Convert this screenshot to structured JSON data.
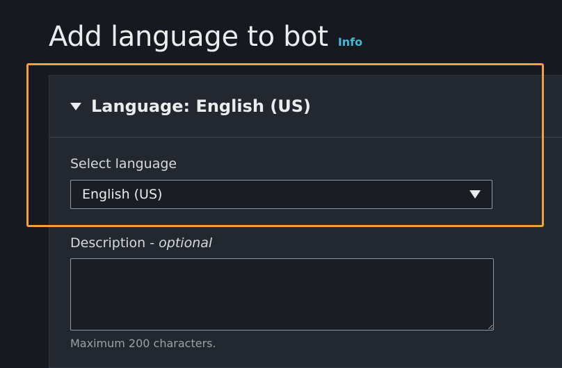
{
  "page": {
    "title": "Add language to bot",
    "info_link": "Info"
  },
  "panel": {
    "title": "Language: English (US)",
    "expanded": true
  },
  "language_field": {
    "label": "Select language",
    "selected": "English (US)"
  },
  "description_field": {
    "label": "Description - ",
    "optional": "optional",
    "value": "",
    "hint": "Maximum 200 characters."
  },
  "colors": {
    "background": "#16191f",
    "panel": "#232730",
    "link": "#44b9d6",
    "highlight": "#f0a03c"
  }
}
